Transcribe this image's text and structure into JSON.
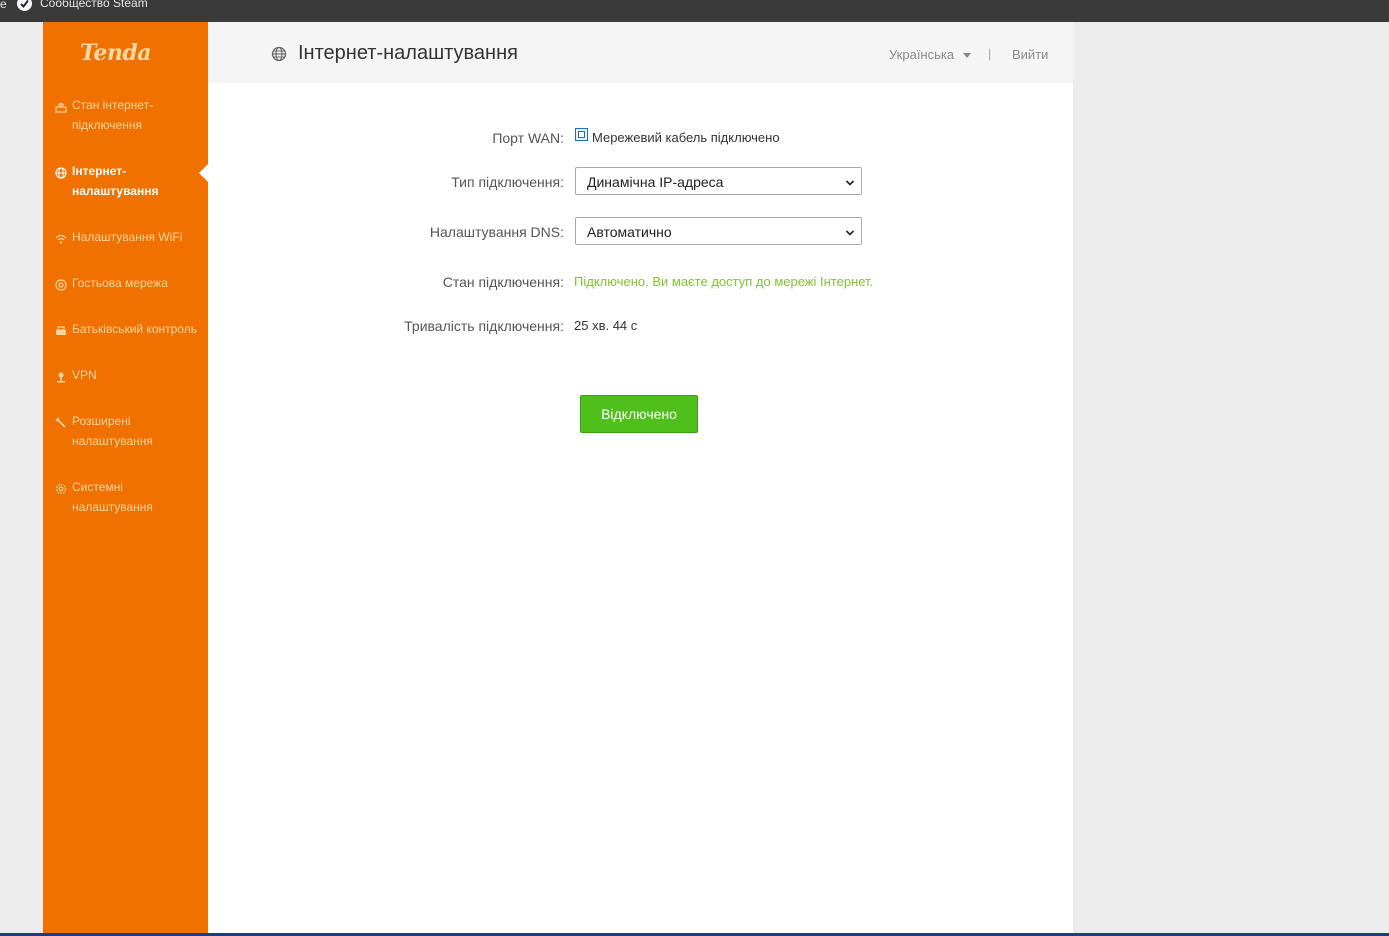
{
  "bookmarks_bar": {
    "edge_fragment": "e",
    "steam_bookmark": "Сообщество Steam"
  },
  "brand": {
    "logo_text": "Tenda",
    "accent_color": "#f07000",
    "button_color": "#4fbf1c",
    "status_color": "#83c233"
  },
  "sidebar": {
    "items": [
      {
        "label": "Стан інтернет-підключення",
        "icon": "router-icon",
        "active": false
      },
      {
        "label": "Інтернет-налаштування",
        "icon": "globe-icon",
        "active": true
      },
      {
        "label": "Налаштування WiFi",
        "icon": "wifi-icon",
        "active": false
      },
      {
        "label": "Гостьова мережа",
        "icon": "guest-network-icon",
        "active": false
      },
      {
        "label": "Батьківський контроль",
        "icon": "parental-control-icon",
        "active": false
      },
      {
        "label": "VPN",
        "icon": "vpn-icon",
        "active": false
      },
      {
        "label": "Розширені налаштування",
        "icon": "wrench-icon",
        "active": false
      },
      {
        "label": "Системні налаштування",
        "icon": "gear-icon",
        "active": false
      }
    ]
  },
  "header": {
    "title": "Інтернет-налаштування",
    "language": "Українська",
    "divider": "|",
    "logout": "Вийти"
  },
  "form": {
    "wan_port": {
      "label": "Порт WAN:",
      "value": "Мережевий кабель підключено"
    },
    "connection_type": {
      "label": "Тип підключення:",
      "selected": "Динамічна IP-адреса"
    },
    "dns": {
      "label": "Налаштування DNS:",
      "selected": "Автоматично"
    },
    "connection_status": {
      "label": "Стан підключення:",
      "value": "Підключено. Ви маєте доступ до мережі Інтернет."
    },
    "connection_duration": {
      "label": "Тривалість підключення:",
      "value": "25 хв. 44 с"
    }
  },
  "actions": {
    "disconnect_label": "Відключено"
  }
}
